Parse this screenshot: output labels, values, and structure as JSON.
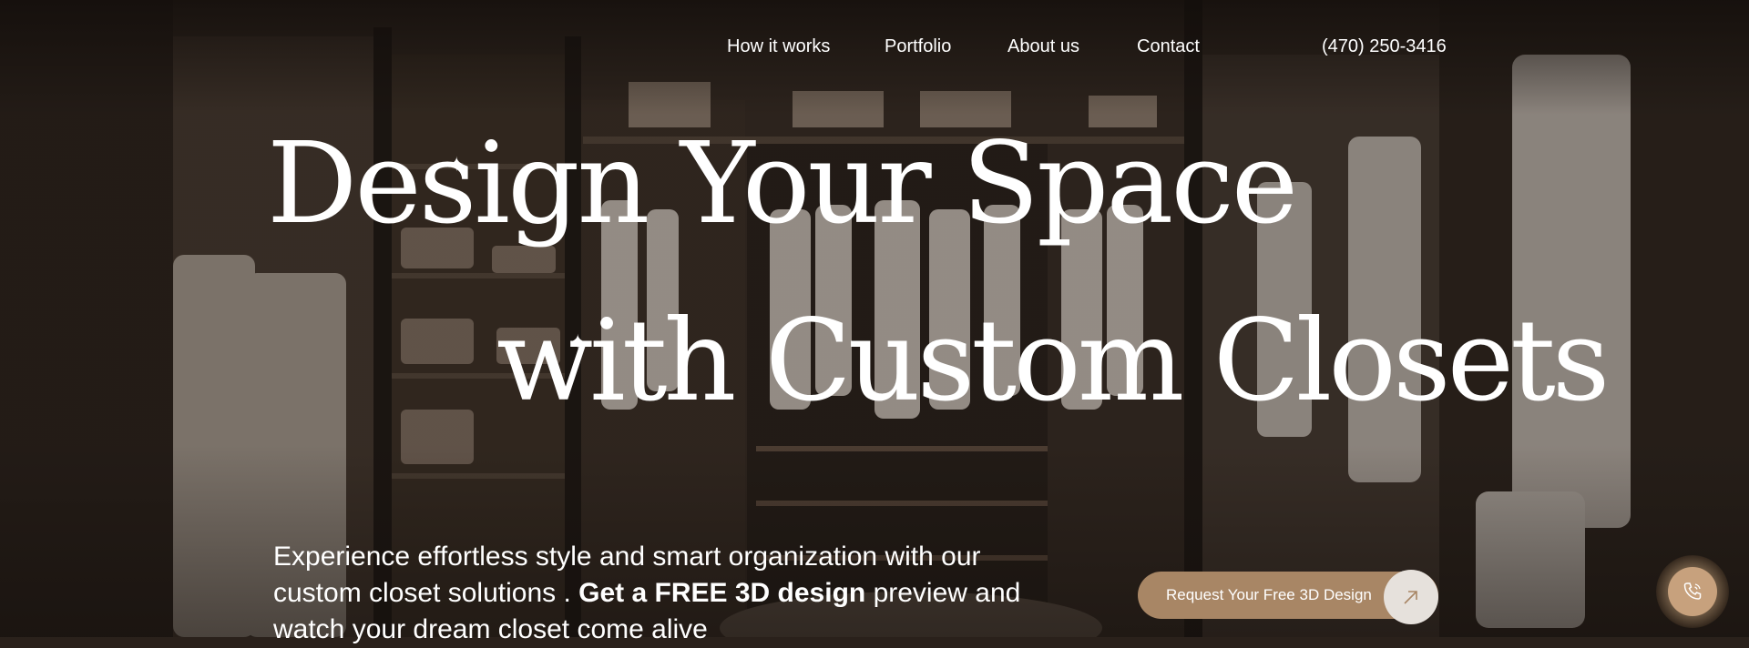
{
  "nav": {
    "items": [
      {
        "label": "How it works"
      },
      {
        "label": "Portfolio"
      },
      {
        "label": "About us"
      },
      {
        "label": "Contact"
      }
    ],
    "phone": "(470) 250-3416"
  },
  "hero": {
    "line1": "Design Your Space",
    "line2": "with Custom Closets",
    "sub_before": "Experience effortless style and smart organization with our custom closet solutions . ",
    "sub_bold": "Get a FREE 3D design",
    "sub_after": " preview and watch your dream closet come alive",
    "cta_label": "Request Your Free 3D Design"
  },
  "icons": {
    "cta_icon": "arrow-up-right-icon",
    "call_icon": "phone-icon",
    "sparkle_icon": "sparkle-icon"
  },
  "colors": {
    "accent": "#a88665",
    "call_button": "#c7a17d",
    "background": "#2a211b"
  }
}
